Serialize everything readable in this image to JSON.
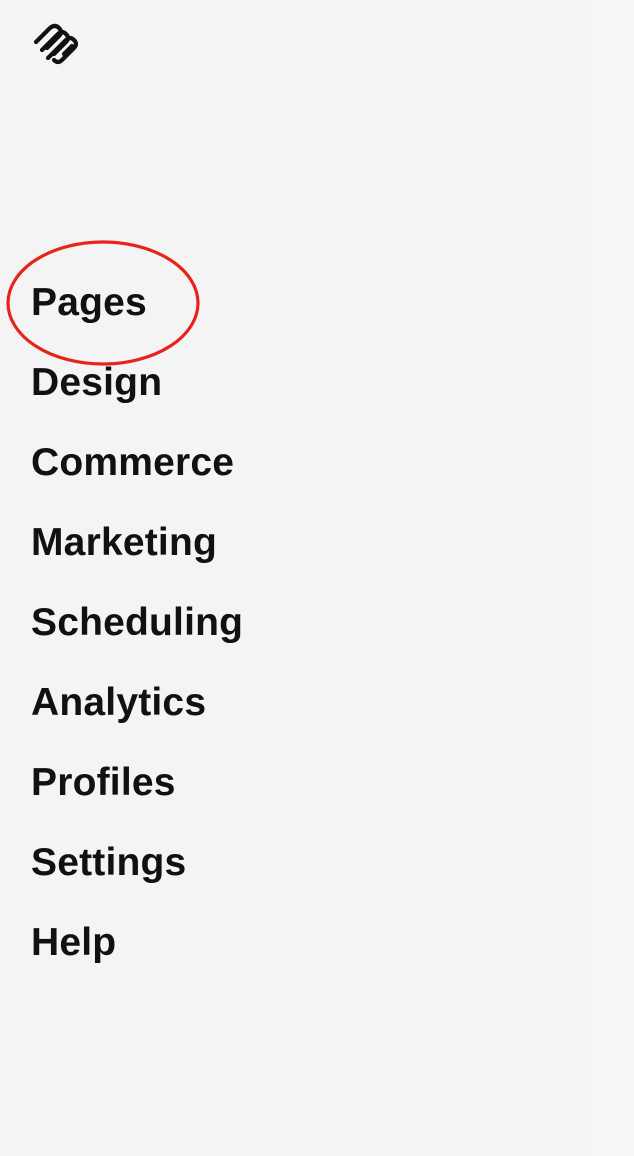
{
  "brand": {
    "logo_icon": "squarespace-logo-icon"
  },
  "sidebar": {
    "items": [
      {
        "label": "Pages"
      },
      {
        "label": "Design"
      },
      {
        "label": "Commerce"
      },
      {
        "label": "Marketing"
      },
      {
        "label": "Scheduling"
      },
      {
        "label": "Analytics"
      },
      {
        "label": "Profiles"
      },
      {
        "label": "Settings"
      },
      {
        "label": "Help"
      }
    ]
  },
  "annotation": {
    "highlight_color": "#e8231a"
  }
}
